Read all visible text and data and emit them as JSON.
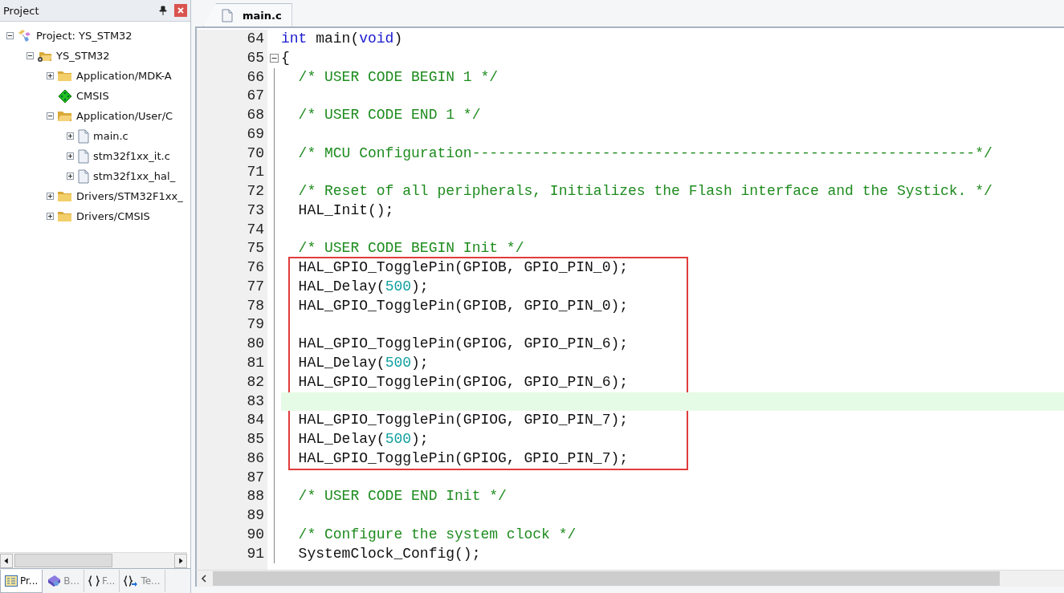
{
  "project_panel": {
    "title": "Project",
    "tree": [
      {
        "label": "Project: YS_STM32",
        "kind": "project",
        "expanded": true,
        "children": [
          {
            "label": "YS_STM32",
            "kind": "target",
            "expanded": true,
            "children": [
              {
                "label": "Application/MDK-A",
                "kind": "folder",
                "expanded": false
              },
              {
                "label": "CMSIS",
                "kind": "component"
              },
              {
                "label": "Application/User/C",
                "kind": "folder",
                "expanded": true,
                "children": [
                  {
                    "label": "main.c",
                    "kind": "file",
                    "expanded": false
                  },
                  {
                    "label": "stm32f1xx_it.c",
                    "kind": "file",
                    "expanded": false
                  },
                  {
                    "label": "stm32f1xx_hal_",
                    "kind": "file",
                    "expanded": false
                  }
                ]
              },
              {
                "label": "Drivers/STM32F1xx_",
                "kind": "folder",
                "expanded": false
              },
              {
                "label": "Drivers/CMSIS",
                "kind": "folder",
                "expanded": false
              }
            ]
          }
        ]
      }
    ],
    "tabs": [
      {
        "label": "Pr...",
        "kind": "project",
        "selected": true
      },
      {
        "label": "B...",
        "kind": "books",
        "selected": false
      },
      {
        "label": "F...",
        "kind": "functions",
        "selected": false
      },
      {
        "label": "Te...",
        "kind": "templates",
        "selected": false
      }
    ]
  },
  "editor": {
    "tabs": [
      {
        "label": "main.c",
        "selected": true
      }
    ],
    "blocks": [
      {
        "boxed": false,
        "lines": [
          {
            "number": "64",
            "fold": false,
            "current": false,
            "tokens": [
              {
                "kind": "keyword",
                "text": "int"
              },
              {
                "kind": "plain",
                "text": " main("
              },
              {
                "kind": "keyword",
                "text": "void"
              },
              {
                "kind": "plain",
                "text": ")"
              }
            ]
          },
          {
            "number": "65",
            "fold": true,
            "current": false,
            "tokens": [
              {
                "kind": "plain",
                "text": "{"
              }
            ]
          },
          {
            "number": "66",
            "fold": false,
            "current": false,
            "tokens": [
              {
                "kind": "comment",
                "text": "  /* USER CODE BEGIN 1 */"
              }
            ]
          },
          {
            "number": "67",
            "fold": false,
            "current": false
          },
          {
            "number": "68",
            "fold": false,
            "current": false,
            "tokens": [
              {
                "kind": "comment",
                "text": "  /* USER CODE END 1 */"
              }
            ]
          },
          {
            "number": "69",
            "fold": false,
            "current": false
          },
          {
            "number": "70",
            "fold": false,
            "current": false,
            "tokens": [
              {
                "kind": "comment",
                "text": "  /* MCU Configuration----------------------------------------------------------*/"
              }
            ]
          },
          {
            "number": "71",
            "fold": false,
            "current": false
          },
          {
            "number": "72",
            "fold": false,
            "current": false,
            "tokens": [
              {
                "kind": "comment",
                "text": "  /* Reset of all peripherals, Initializes the Flash interface and the Systick. */"
              }
            ]
          },
          {
            "number": "73",
            "fold": false,
            "current": false,
            "tokens": [
              {
                "kind": "plain",
                "text": "  HAL_Init();"
              }
            ]
          },
          {
            "number": "74",
            "fold": false,
            "current": false
          },
          {
            "number": "75",
            "fold": false,
            "current": false,
            "tokens": [
              {
                "kind": "comment",
                "text": "  /* USER CODE BEGIN Init */"
              }
            ]
          }
        ]
      },
      {
        "boxed": true,
        "lines": [
          {
            "number": "76",
            "fold": false,
            "current": false,
            "tokens": [
              {
                "kind": "plain",
                "text": "  HAL_GPIO_TogglePin(GPIOB, GPIO_PIN_0);"
              }
            ]
          },
          {
            "number": "77",
            "fold": false,
            "current": false,
            "tokens": [
              {
                "kind": "plain",
                "text": "  HAL_Delay("
              },
              {
                "kind": "number",
                "text": "500"
              },
              {
                "kind": "plain",
                "text": ");"
              }
            ]
          },
          {
            "number": "78",
            "fold": false,
            "current": false,
            "tokens": [
              {
                "kind": "plain",
                "text": "  HAL_GPIO_TogglePin(GPIOB, GPIO_PIN_0);"
              }
            ]
          },
          {
            "number": "79",
            "fold": false,
            "current": false
          },
          {
            "number": "80",
            "fold": false,
            "current": false,
            "tokens": [
              {
                "kind": "plain",
                "text": "  HAL_GPIO_TogglePin(GPIOG, GPIO_PIN_6);"
              }
            ]
          },
          {
            "number": "81",
            "fold": false,
            "current": false,
            "tokens": [
              {
                "kind": "plain",
                "text": "  HAL_Delay("
              },
              {
                "kind": "number",
                "text": "500"
              },
              {
                "kind": "plain",
                "text": ");"
              }
            ]
          },
          {
            "number": "82",
            "fold": false,
            "current": false,
            "tokens": [
              {
                "kind": "plain",
                "text": "  HAL_GPIO_TogglePin(GPIOG, GPIO_PIN_6);"
              }
            ]
          },
          {
            "number": "83",
            "fold": false,
            "current": true
          },
          {
            "number": "84",
            "fold": false,
            "current": false,
            "tokens": [
              {
                "kind": "plain",
                "text": "  HAL_GPIO_TogglePin(GPIOG, GPIO_PIN_7);"
              }
            ]
          },
          {
            "number": "85",
            "fold": false,
            "current": false,
            "tokens": [
              {
                "kind": "plain",
                "text": "  HAL_Delay("
              },
              {
                "kind": "number",
                "text": "500"
              },
              {
                "kind": "plain",
                "text": ");"
              }
            ]
          },
          {
            "number": "86",
            "fold": false,
            "current": false,
            "tokens": [
              {
                "kind": "plain",
                "text": "  HAL_GPIO_TogglePin(GPIOG, GPIO_PIN_7);"
              }
            ]
          }
        ]
      },
      {
        "boxed": false,
        "lines": [
          {
            "number": "87",
            "fold": false,
            "current": false
          },
          {
            "number": "88",
            "fold": false,
            "current": false,
            "tokens": [
              {
                "kind": "comment",
                "text": "  /* USER CODE END Init */"
              }
            ]
          },
          {
            "number": "89",
            "fold": false,
            "current": false
          },
          {
            "number": "90",
            "fold": false,
            "current": false,
            "tokens": [
              {
                "kind": "comment",
                "text": "  /* Configure the system clock */"
              }
            ]
          },
          {
            "number": "91",
            "fold": false,
            "current": false,
            "tokens": [
              {
                "kind": "plain",
                "text": "  SystemClock_Config();"
              }
            ]
          }
        ]
      }
    ]
  }
}
